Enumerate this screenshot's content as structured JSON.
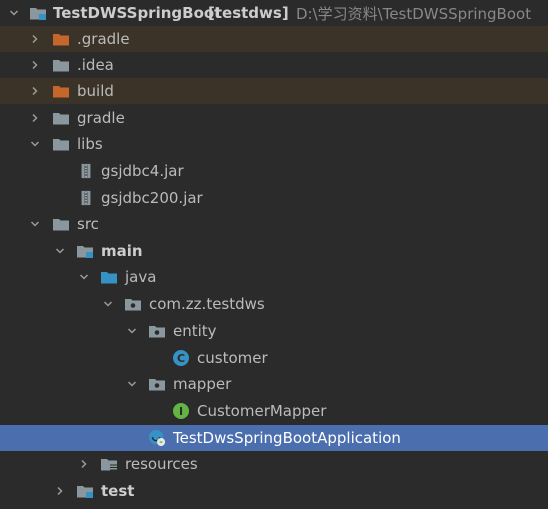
{
  "colors": {
    "background": "#2b2b2b",
    "text": "#bbbbbb",
    "selection": "#4b6eaf",
    "excluded_row": "#3b3228",
    "excluded_folder": "#c5672c",
    "folder": "#8b979f",
    "source_folder": "#3592c4",
    "class_badge": "#3592c4",
    "interface_badge": "#62b543"
  },
  "tree": {
    "root": {
      "name": "TestDWSSpringBoot",
      "module": "[testdws]",
      "path": "D:\\学习资料\\TestDWSSpringBoot",
      "icon": "module-folder-icon"
    },
    "nodes": [
      {
        "label": ".gradle",
        "icon": "excluded-folder-icon",
        "state": "collapsed"
      },
      {
        "label": ".idea",
        "icon": "folder-icon",
        "state": "collapsed"
      },
      {
        "label": "build",
        "icon": "excluded-folder-icon",
        "state": "collapsed"
      },
      {
        "label": "gradle",
        "icon": "folder-icon",
        "state": "collapsed"
      },
      {
        "label": "libs",
        "icon": "folder-icon",
        "state": "expanded"
      },
      {
        "label": "gsjdbc4.jar",
        "icon": "jar-icon",
        "state": "leaf"
      },
      {
        "label": "gsjdbc200.jar",
        "icon": "jar-icon",
        "state": "leaf"
      },
      {
        "label": "src",
        "icon": "folder-icon",
        "state": "expanded"
      },
      {
        "label": "main",
        "icon": "module-folder-icon",
        "state": "expanded"
      },
      {
        "label": "java",
        "icon": "source-folder-icon",
        "state": "expanded"
      },
      {
        "label": "com.zz.testdws",
        "icon": "package-icon",
        "state": "expanded"
      },
      {
        "label": "entity",
        "icon": "package-icon",
        "state": "expanded"
      },
      {
        "label": "customer",
        "icon": "class-icon",
        "state": "leaf",
        "badge": "C"
      },
      {
        "label": "mapper",
        "icon": "package-icon",
        "state": "expanded"
      },
      {
        "label": "CustomerMapper",
        "icon": "interface-icon",
        "state": "leaf",
        "badge": "I"
      },
      {
        "label": "TestDwsSpringBootApplication",
        "icon": "spring-boot-class-icon",
        "state": "leaf",
        "selected": true
      },
      {
        "label": "resources",
        "icon": "resources-folder-icon",
        "state": "collapsed"
      },
      {
        "label": "test",
        "icon": "module-folder-icon",
        "state": "collapsed"
      }
    ]
  }
}
